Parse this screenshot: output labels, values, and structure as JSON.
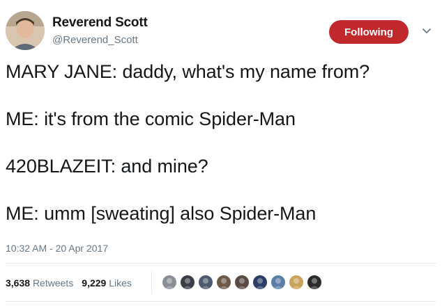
{
  "user": {
    "display_name": "Reverend Scott",
    "handle": "@Reverend_Scott"
  },
  "follow_button": {
    "label": "Following",
    "color": "#c0282c"
  },
  "tweet": {
    "lines": [
      "MARY JANE: daddy, what's my name from?",
      "ME: it's from the comic Spider-Man",
      "420BLAZEIT: and mine?",
      "ME: umm [sweating] also Spider-Man"
    ],
    "timestamp": "10:32 AM - 20 Apr 2017"
  },
  "stats": {
    "retweets_count": "3,638",
    "retweets_label": "Retweets",
    "likes_count": "9,229",
    "likes_label": "Likes"
  },
  "icons": {
    "menu": "chevron-down-icon"
  },
  "liker_colors": [
    "#8a8f96",
    "#3a3f47",
    "#4b5a6e",
    "#6d5a4a",
    "#5a4b42",
    "#2c3e66",
    "#5b7fa6",
    "#c8a35a",
    "#2b2b2b"
  ]
}
